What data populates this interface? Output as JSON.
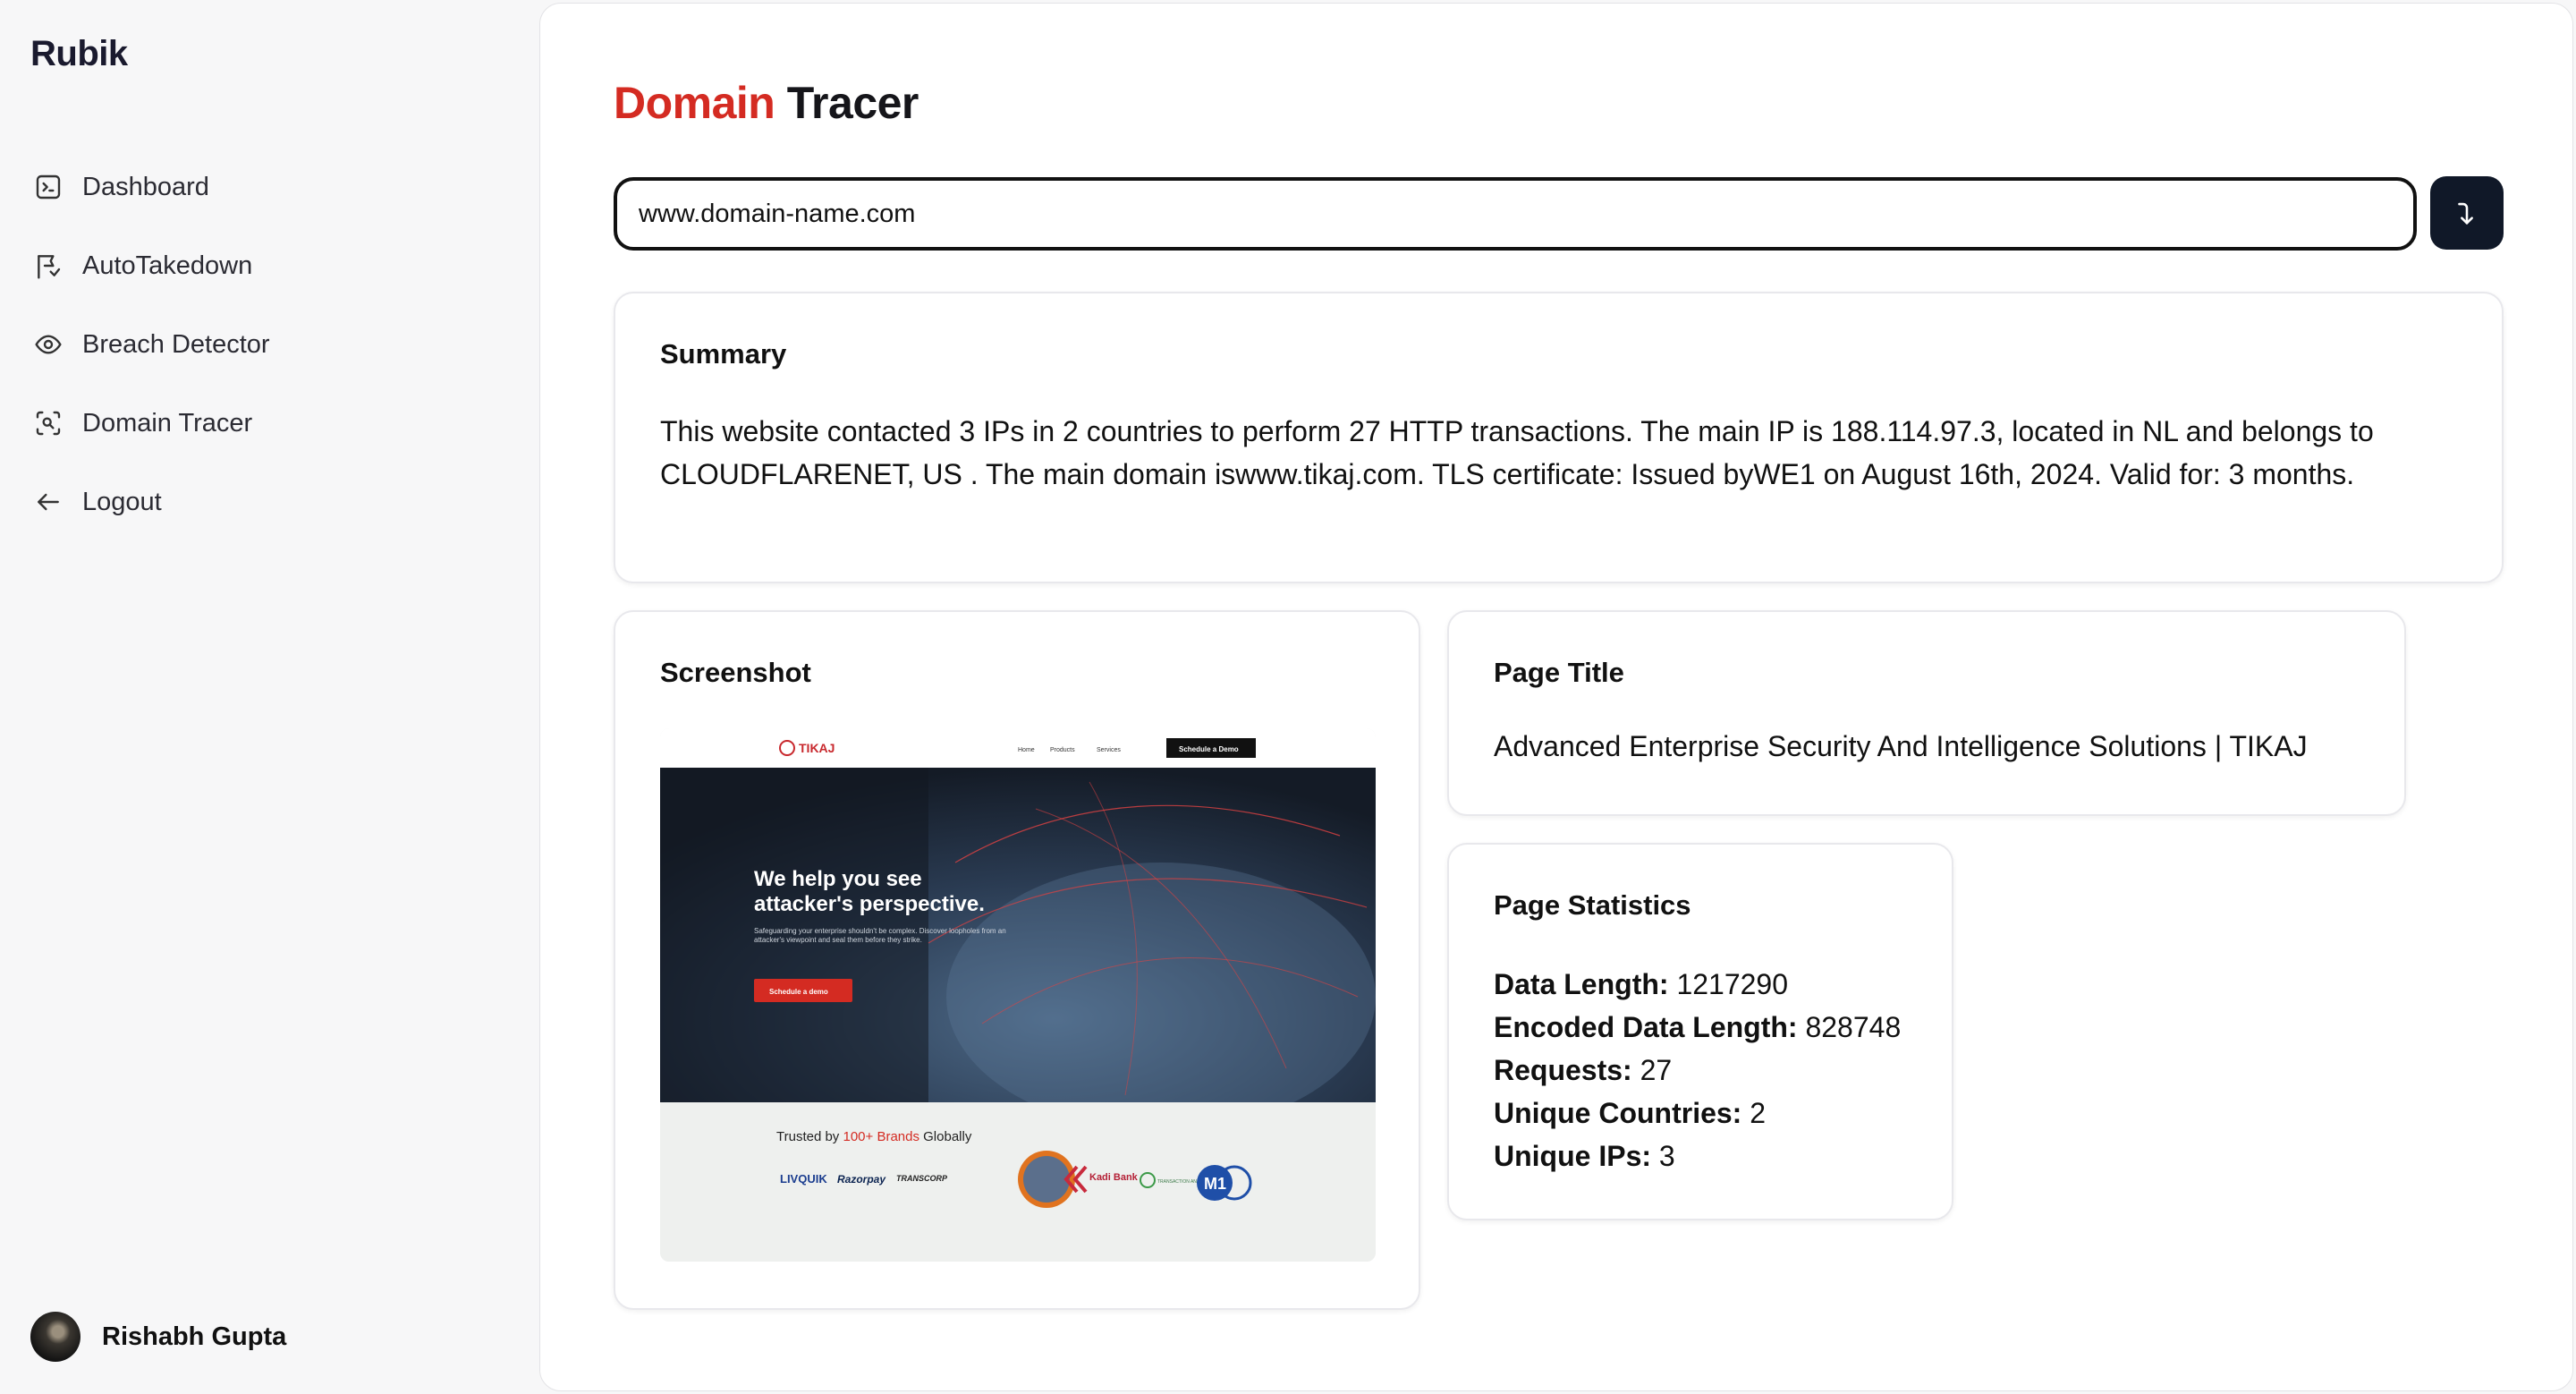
{
  "app": {
    "name": "Rubik"
  },
  "sidebar": {
    "items": [
      {
        "label": "Dashboard",
        "icon": "terminal-square-icon"
      },
      {
        "label": "AutoTakedown",
        "icon": "flag-arrow-icon"
      },
      {
        "label": "Breach Detector",
        "icon": "eye-icon"
      },
      {
        "label": "Domain Tracer",
        "icon": "scan-face-icon"
      },
      {
        "label": "Logout",
        "icon": "arrow-left-icon"
      }
    ]
  },
  "user": {
    "name": "Rishabh Gupta"
  },
  "page": {
    "title_accent": "Domain",
    "title_rest": "Tracer",
    "accent_color": "#d42b22"
  },
  "search": {
    "value": "www.domain-name.com",
    "button_icon": "arrow-turn-down-icon"
  },
  "summary": {
    "heading": "Summary",
    "text": "This website contacted 3 IPs in 2 countries to perform 27 HTTP transactions. The main IP is 188.114.97.3, located in NL and belongs to CLOUDFLARENET, US . The main domain iswww.tikaj.com. TLS certificate: Issued byWE1 on August 16th, 2024. Valid for: 3 months."
  },
  "screenshot": {
    "heading": "Screenshot",
    "site": {
      "logo": "TIKAJ",
      "nav": [
        "Home",
        "Products",
        "Services"
      ],
      "cta": "Schedule a Demo",
      "hero_line1": "We help you see",
      "hero_line2": "attacker's perspective.",
      "hero_sub": "Safeguarding your enterprise shouldn't be complex. Discover loopholes from an attacker's viewpoint and seal them before they strike.",
      "hero_btn": "Schedule a demo",
      "trusted_prefix": "Trusted by",
      "trusted_accent": "100+ Brands",
      "trusted_suffix": "Globally",
      "brands": [
        "LIVQUIK",
        "Razorpay",
        "TRANSCORP",
        "Kadi Bank",
        "TRANSACTION ANALYSTS",
        "M1"
      ]
    }
  },
  "page_title": {
    "heading": "Page Title",
    "value": "Advanced Enterprise Security And Intelligence Solutions | TIKAJ"
  },
  "page_stats": {
    "heading": "Page Statistics",
    "rows": [
      {
        "label": "Data Length:",
        "value": "1217290"
      },
      {
        "label": "Encoded Data Length:",
        "value": "828748"
      },
      {
        "label": "Requests:",
        "value": "27"
      },
      {
        "label": "Unique Countries:",
        "value": "2"
      },
      {
        "label": "Unique IPs:",
        "value": "3"
      }
    ]
  }
}
